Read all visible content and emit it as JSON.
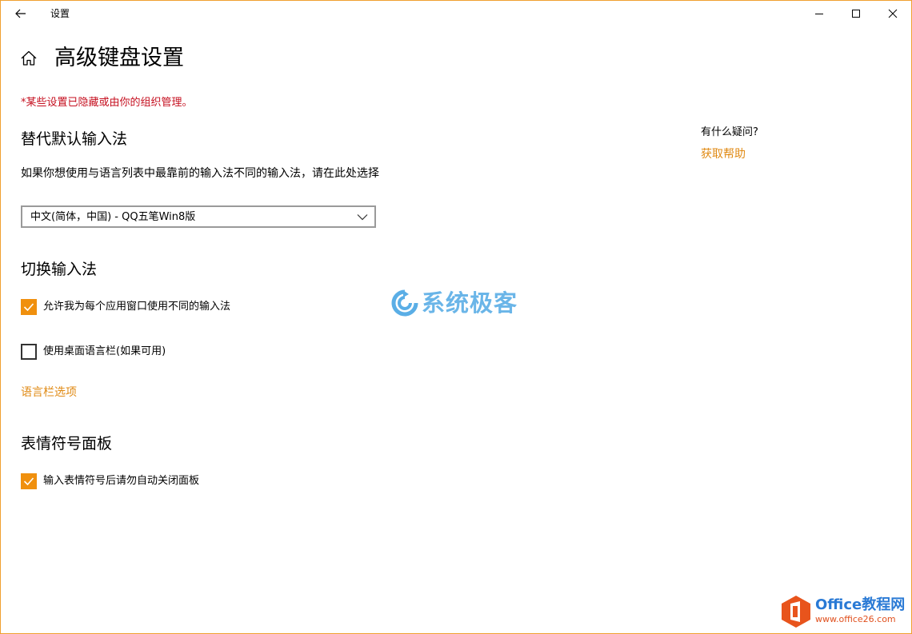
{
  "window": {
    "title": "设置",
    "accent_color": "#f0900e",
    "border_color": "#f0a030"
  },
  "header": {
    "page_title": "高级键盘设置"
  },
  "notice": {
    "text": "*某些设置已隐藏或由你的组织管理。",
    "color": "#c50f1f"
  },
  "override_input": {
    "title": "替代默认输入法",
    "description": "如果你想使用与语言列表中最靠前的输入法不同的输入法，请在此处选择",
    "dropdown_value": "中文(简体，中国) - QQ五笔Win8版"
  },
  "switch_input": {
    "title": "切换输入法",
    "options": [
      {
        "label": "允许我为每个应用窗口使用不同的输入法",
        "checked": true
      },
      {
        "label": "使用桌面语言栏(如果可用)",
        "checked": false
      }
    ],
    "link": "语言栏选项"
  },
  "emoji_panel": {
    "title": "表情符号面板",
    "options": [
      {
        "label": "输入表情符号后请勿自动关闭面板",
        "checked": true
      }
    ]
  },
  "sidebar": {
    "question": "有什么疑问?",
    "help_link": "获取帮助",
    "link_color": "#e08a14"
  },
  "watermarks": {
    "center": "系统极客",
    "office_brand": "Office教程网",
    "office_url": "www.office26.com"
  }
}
